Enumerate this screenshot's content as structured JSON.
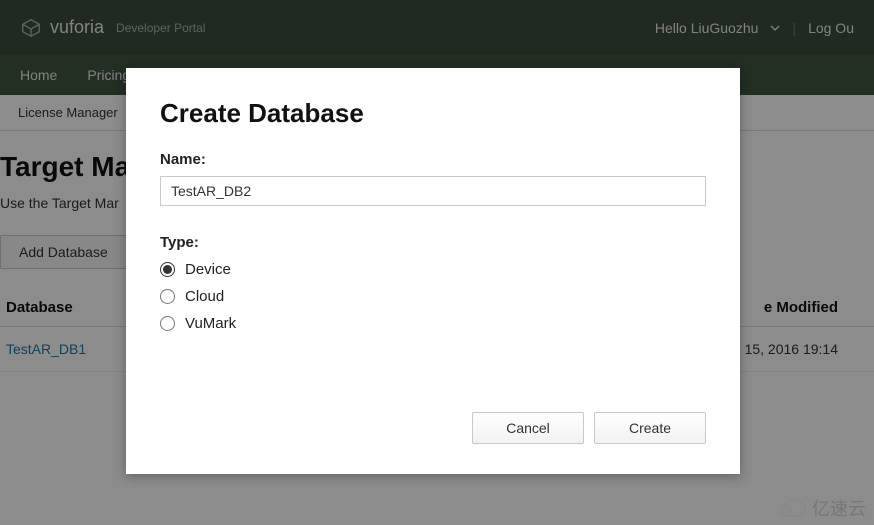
{
  "header": {
    "brand": "vuforia",
    "brand_sub": "Developer Portal",
    "greeting": "Hello LiuGuozhu",
    "logout": "Log Ou"
  },
  "nav": {
    "home": "Home",
    "pricing": "Pricing"
  },
  "subnav": {
    "license": "License Manager"
  },
  "page": {
    "title": "Target Mar",
    "desc": "Use the Target Mar",
    "add_button": "Add Database"
  },
  "table": {
    "col_database": "Database",
    "col_modified": "e Modified",
    "rows": [
      {
        "name": "TestAR_DB1",
        "modified": "15, 2016 19:14"
      }
    ]
  },
  "modal": {
    "title": "Create Database",
    "name_label": "Name:",
    "name_value": "TestAR_DB2",
    "type_label": "Type:",
    "options": {
      "device": "Device",
      "cloud": "Cloud",
      "vumark": "VuMark"
    },
    "selected_type": "device",
    "cancel": "Cancel",
    "create": "Create"
  },
  "watermark": "亿速云"
}
